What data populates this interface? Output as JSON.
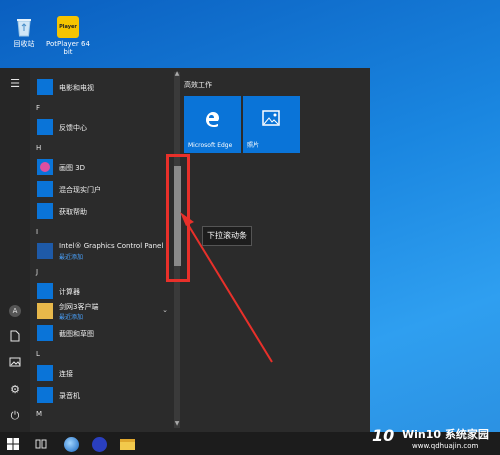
{
  "desktop": {
    "icons": [
      {
        "label": "回收站"
      },
      {
        "label": "PotPlayer 64 bit",
        "badge": "Player"
      }
    ]
  },
  "start_menu": {
    "groups": [
      {
        "letter": "F"
      },
      {
        "letter": "H"
      },
      {
        "letter": "I"
      },
      {
        "letter": "J"
      },
      {
        "letter": "L"
      },
      {
        "letter": "M"
      }
    ],
    "apps": [
      {
        "label": "电影和电视"
      },
      {
        "label": "反馈中心"
      },
      {
        "label": "画图 3D"
      },
      {
        "label": "混合现实门户"
      },
      {
        "label": "获取帮助"
      },
      {
        "label": "Intel® Graphics Control Panel",
        "sub": "最近添加"
      },
      {
        "label": "计算器"
      },
      {
        "label": "剑网3客户端",
        "sub": "最近添加"
      },
      {
        "label": "截图和草图"
      },
      {
        "label": "连接"
      },
      {
        "label": "录音机"
      }
    ],
    "rail_avatar": "A",
    "tiles_title": "高效工作",
    "tiles": [
      {
        "label": "Microsoft Edge",
        "icon": "edge-icon"
      },
      {
        "label": "照片",
        "icon": "photos-icon"
      }
    ]
  },
  "annotation": {
    "callout": "下拉滚动条",
    "color": "#e8302a"
  },
  "watermark": {
    "logo": "10",
    "text": "Win10 系统家园",
    "url": "www.qdhuajin.com"
  },
  "colors": {
    "accent": "#0a74d8",
    "menu_bg": "#2b2b2b",
    "taskbar": "#1c1c1c",
    "sub_text": "#4aa3ff"
  }
}
